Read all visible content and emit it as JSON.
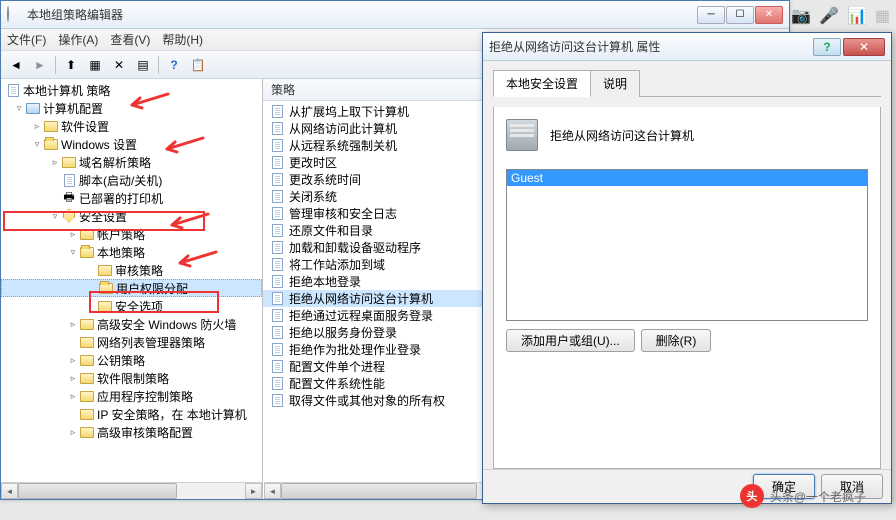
{
  "window": {
    "title": "本地组策略编辑器"
  },
  "menubar": {
    "file": "文件(F)",
    "action": "操作(A)",
    "view": "查看(V)",
    "help": "帮助(H)"
  },
  "tree": {
    "root": "本地计算机 策略",
    "computer_config": "计算机配置",
    "software_settings": "软件设置",
    "windows_settings": "Windows 设置",
    "dns_policy": "域名解析策略",
    "scripts": "脚本(启动/关机)",
    "deployed_printers": "已部署的打印机",
    "security_settings": "安全设置",
    "account_policies": "帐户策略",
    "local_policies": "本地策略",
    "audit_policy": "审核策略",
    "user_rights": "用户权限分配",
    "security_options": "安全选项",
    "windows_firewall": "高级安全 Windows 防火墙",
    "network_list": "网络列表管理器策略",
    "public_key": "公钥策略",
    "software_restriction": "软件限制策略",
    "app_control": "应用程序控制策略",
    "ip_security": "IP 安全策略，在 本地计算机",
    "advanced_audit": "高级审核策略配置"
  },
  "policy_header": "策略",
  "policies": [
    "从扩展坞上取下计算机",
    "从网络访问此计算机",
    "从远程系统强制关机",
    "更改时区",
    "更改系统时间",
    "关闭系统",
    "管理审核和安全日志",
    "还原文件和目录",
    "加载和卸载设备驱动程序",
    "将工作站添加到域",
    "拒绝本地登录",
    "拒绝从网络访问这台计算机",
    "拒绝通过远程桌面服务登录",
    "拒绝以服务身份登录",
    "拒绝作为批处理作业登录",
    "配置文件单个进程",
    "配置文件系统性能",
    "取得文件或其他对象的所有权"
  ],
  "dialog": {
    "title": "拒绝从网络访问这台计算机 属性",
    "tab_local": "本地安全设置",
    "tab_explain": "说明",
    "policy_name": "拒绝从网络访问这台计算机",
    "user_guest": "Guest",
    "add_user": "添加用户或组(U)...",
    "remove": "删除(R)",
    "ok": "确定",
    "cancel": "取消"
  },
  "watermark": "头条@一个老疯子"
}
